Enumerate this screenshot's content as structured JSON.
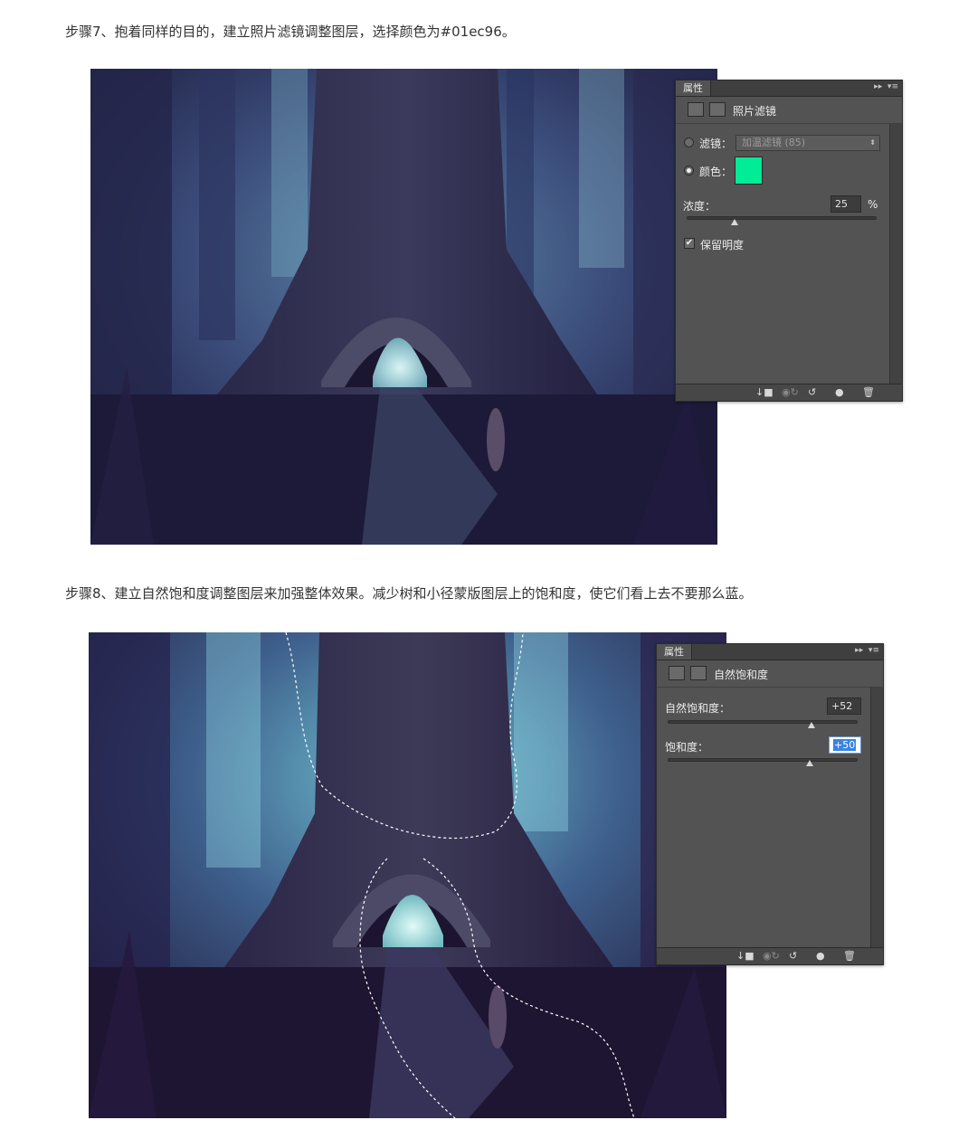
{
  "step7": {
    "text": "步骤7、抱着同样的目的，建立照片滤镜调整图层，选择颜色为#01ec96。",
    "panel": {
      "tab_label": "属性",
      "title": "照片滤镜",
      "filter_label": "滤镜：",
      "filter_value": "加温滤镜 (85)",
      "color_label": "颜色：",
      "color_value": "#01ec96",
      "density_label": "浓度：",
      "density_value": "25",
      "density_unit": "%",
      "density_slider": 0.25,
      "preserve_label": "保留明度",
      "preserve_checked": true
    }
  },
  "step8": {
    "text": "步骤8、建立自然饱和度调整图层来加强整体效果。减少树和小径蒙版图层上的饱和度，使它们看上去不要那么蓝。",
    "panel": {
      "tab_label": "属性",
      "title": "自然饱和度",
      "vibrance_label": "自然饱和度：",
      "vibrance_value": "+52",
      "saturation_label": "饱和度：",
      "saturation_value": "+50"
    }
  },
  "icons": {
    "adjustment": "camera-icon",
    "mask": "mask-icon",
    "vibrance": "triangle-icon",
    "clip": "clip-to-layer-icon",
    "view_prev": "view-previous-icon",
    "reset": "reset-icon",
    "visibility": "eye-icon",
    "delete": "trash-icon"
  }
}
